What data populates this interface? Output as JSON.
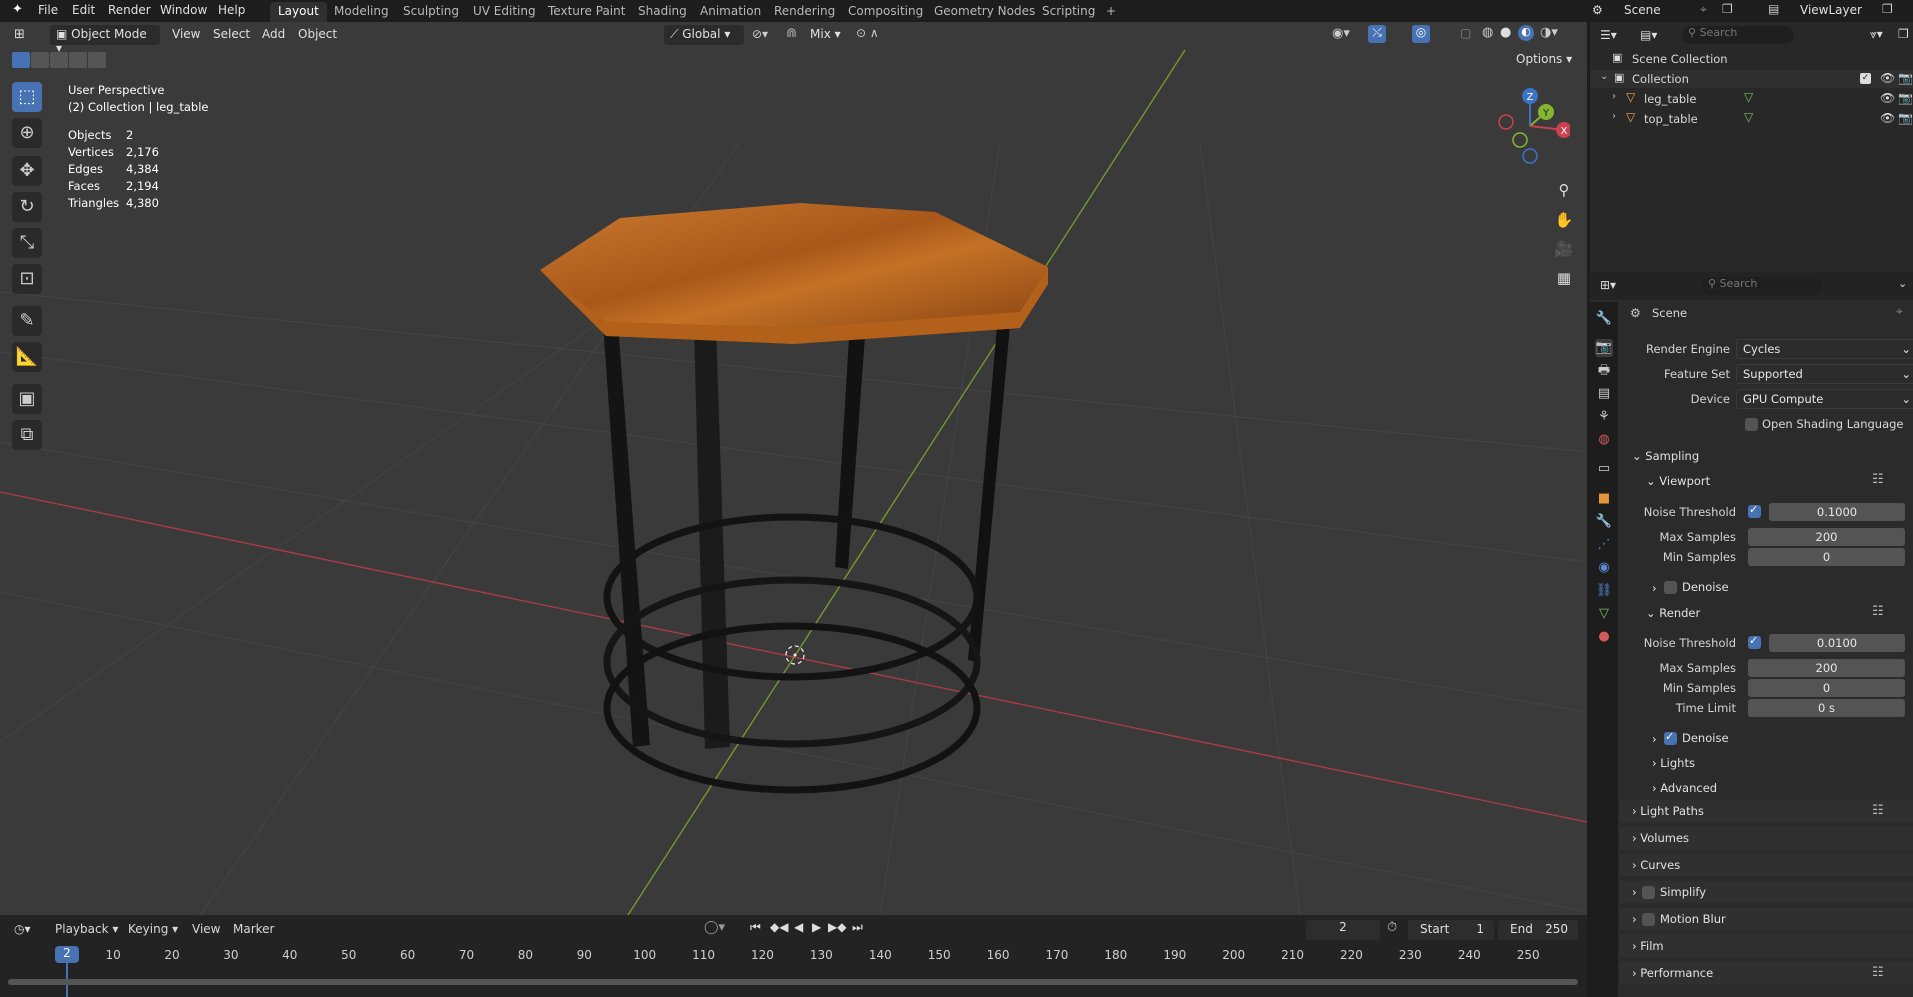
{
  "topbar": {
    "menus": [
      "File",
      "Edit",
      "Render",
      "Window",
      "Help"
    ],
    "workspaces": [
      "Layout",
      "Modeling",
      "Sculpting",
      "UV Editing",
      "Texture Paint",
      "Shading",
      "Animation",
      "Rendering",
      "Compositing",
      "Geometry Nodes",
      "Scripting"
    ],
    "active_workspace": "Layout",
    "add_tab": "+",
    "scene_name": "Scene",
    "view_layer": "ViewLayer"
  },
  "viewport": {
    "mode": "Object Mode",
    "menus": [
      "View",
      "Select",
      "Add",
      "Object"
    ],
    "transform_orientation": "Global",
    "snap_mode": "Mix",
    "options_label": "Options",
    "perspective_label": "User Perspective",
    "collection_label": "(2) Collection | leg_table",
    "stats": [
      {
        "label": "Objects",
        "value": "2"
      },
      {
        "label": "Vertices",
        "value": "2,176"
      },
      {
        "label": "Edges",
        "value": "4,384"
      },
      {
        "label": "Faces",
        "value": "2,194"
      },
      {
        "label": "Triangles",
        "value": "4,380"
      }
    ],
    "gizmo": {
      "x": "X",
      "y": "Y",
      "z": "Z"
    },
    "colors": {
      "x_axis": "#c44a55",
      "y_axis": "#7fa52a",
      "table_top": "#b8661f",
      "legs": "#141414"
    }
  },
  "timeline": {
    "menus": [
      "Playback",
      "Keying",
      "View",
      "Marker"
    ],
    "current_frame": "2",
    "start_label": "Start",
    "start_value": "1",
    "end_label": "End",
    "end_value": "250",
    "ticks": [
      "2",
      "10",
      "20",
      "30",
      "40",
      "50",
      "60",
      "70",
      "80",
      "90",
      "100",
      "110",
      "120",
      "130",
      "140",
      "150",
      "160",
      "170",
      "180",
      "190",
      "200",
      "210",
      "220",
      "230",
      "240",
      "250"
    ]
  },
  "outliner": {
    "search_placeholder": "Search",
    "root": "Scene Collection",
    "collection": "Collection",
    "objects": [
      "leg_table",
      "top_table"
    ]
  },
  "properties": {
    "search_placeholder": "Search",
    "context": "Scene",
    "render_engine": {
      "label": "Render Engine",
      "value": "Cycles"
    },
    "feature_set": {
      "label": "Feature Set",
      "value": "Supported"
    },
    "device": {
      "label": "Device",
      "value": "GPU Compute"
    },
    "osl_label": "Open Shading Language",
    "sampling": {
      "title": "Sampling",
      "viewport": {
        "title": "Viewport",
        "noise_threshold": {
          "label": "Noise Threshold",
          "value": "0.1000"
        },
        "max_samples": {
          "label": "Max Samples",
          "value": "200"
        },
        "min_samples": {
          "label": "Min Samples",
          "value": "0"
        },
        "denoise": "Denoise"
      },
      "render": {
        "title": "Render",
        "noise_threshold": {
          "label": "Noise Threshold",
          "value": "0.0100"
        },
        "max_samples": {
          "label": "Max Samples",
          "value": "200"
        },
        "min_samples": {
          "label": "Min Samples",
          "value": "0"
        },
        "time_limit": {
          "label": "Time Limit",
          "value": "0 s"
        },
        "denoise": "Denoise"
      },
      "lights": "Lights",
      "advanced": "Advanced"
    },
    "panels": [
      "Light Paths",
      "Volumes",
      "Curves",
      "Simplify",
      "Motion Blur",
      "Film",
      "Performance"
    ]
  }
}
